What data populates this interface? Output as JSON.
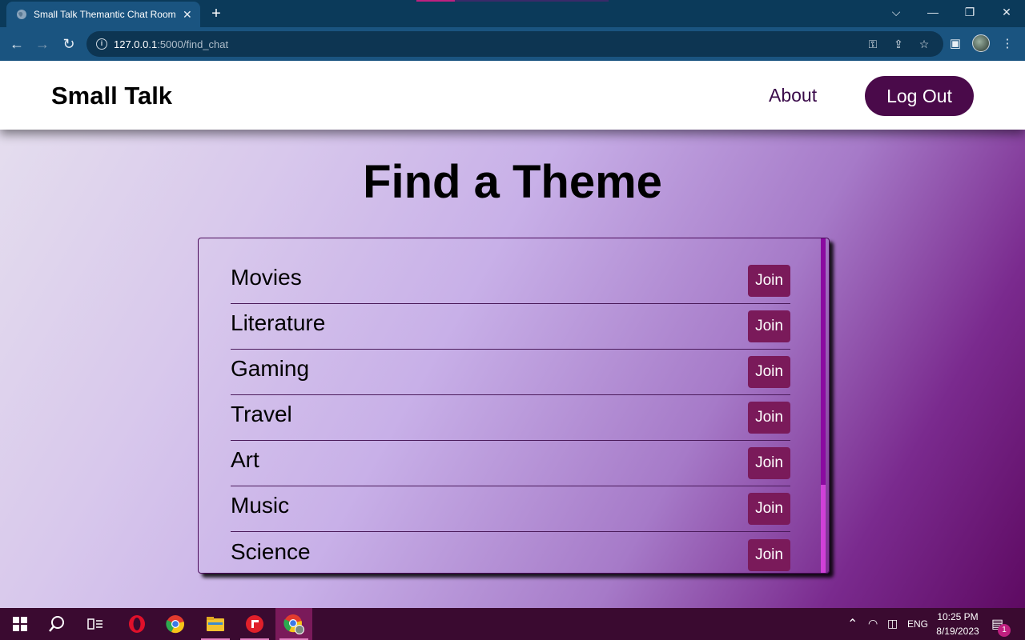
{
  "browser": {
    "tab_title": "Small Talk Themantic Chat Room",
    "tab_close": "✕",
    "new_tab": "+",
    "url_host": "127.0.0.1",
    "url_path": ":5000/find_chat",
    "window_controls": {
      "tabsearch": "⌵",
      "minimize": "—",
      "restore": "❐",
      "close": "✕"
    }
  },
  "header": {
    "logo": "Small Talk",
    "about": "About",
    "logout": "Log Out"
  },
  "page": {
    "heading": "Find a Theme"
  },
  "themes": [
    {
      "name": "Movies",
      "join": "Join"
    },
    {
      "name": "Literature",
      "join": "Join"
    },
    {
      "name": "Gaming",
      "join": "Join"
    },
    {
      "name": "Travel",
      "join": "Join"
    },
    {
      "name": "Art",
      "join": "Join"
    },
    {
      "name": "Music",
      "join": "Join"
    },
    {
      "name": "Science",
      "join": "Join"
    }
  ],
  "taskbar": {
    "language": "ENG",
    "time": "10:25 PM",
    "date": "8/19/2023",
    "notification_count": "1"
  },
  "colors": {
    "header_bg": "#ffffff",
    "logout_bg": "#4a0a4a",
    "join_bg": "#7a1a5a",
    "taskbar_bg": "#3a0a30",
    "chrome_bg": "#1a5480"
  }
}
